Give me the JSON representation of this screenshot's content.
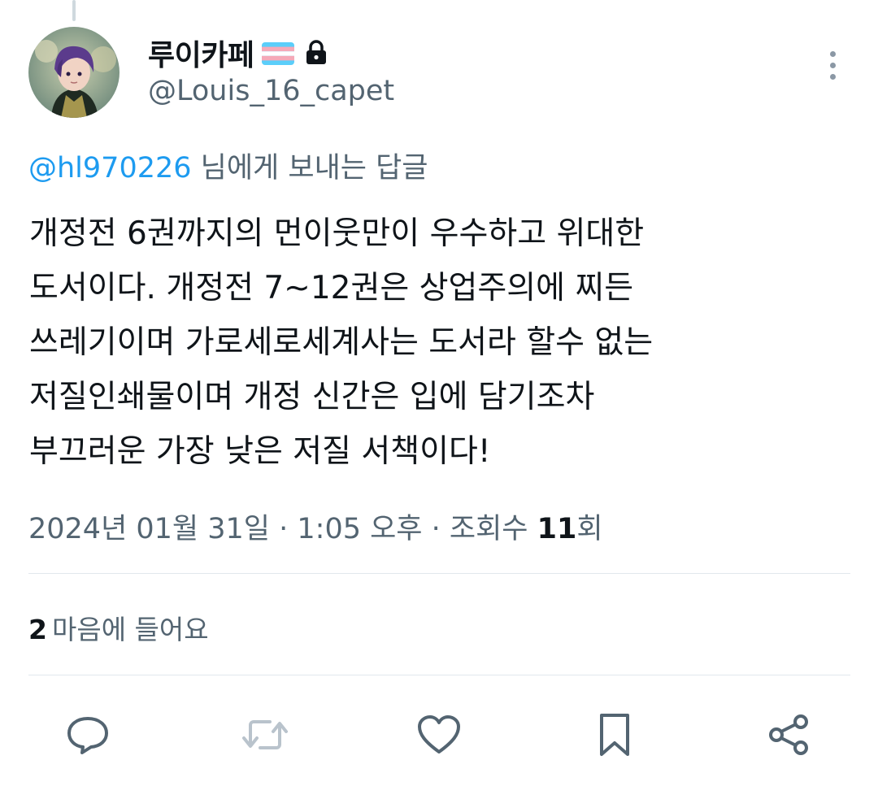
{
  "user": {
    "display_name": "루이카페",
    "flag_icon": "transgender-flag-icon",
    "lock_icon": "lock-icon",
    "handle": "@Louis_16_capet"
  },
  "reply_context": {
    "mention": "@hl970226",
    "suffix": " 님에게 보내는 답글"
  },
  "tweet": {
    "lines": [
      "개정전 6권까지의 먼이웃만이 우수하고 위대한",
      "도서이다. 개정전 7~12권은 상업주의에 찌든",
      "쓰레기이며 가로세로세계사는 도서라 할수 없는",
      "저질인쇄물이며 개정 신간은 입에 담기조차",
      "부끄러운 가장 낮은 저질 서책이다!"
    ]
  },
  "meta": {
    "date": "2024년 01월 31일",
    "separator": " · ",
    "time": "1:05 오후",
    "views_label": "조회수 ",
    "views_count": "11",
    "views_unit": "회"
  },
  "engagement": {
    "likes_count": "2",
    "likes_label": "마음에 들어요"
  },
  "actions": {
    "reply_icon": "reply-icon",
    "retweet_icon": "retweet-icon",
    "like_icon": "heart-icon",
    "bookmark_icon": "bookmark-icon",
    "share_icon": "share-icon"
  },
  "colors": {
    "text_primary": "#0f1419",
    "text_secondary": "#536471",
    "accent": "#1d9bf0",
    "icon": "#536471",
    "divider": "#e1e8ed"
  }
}
